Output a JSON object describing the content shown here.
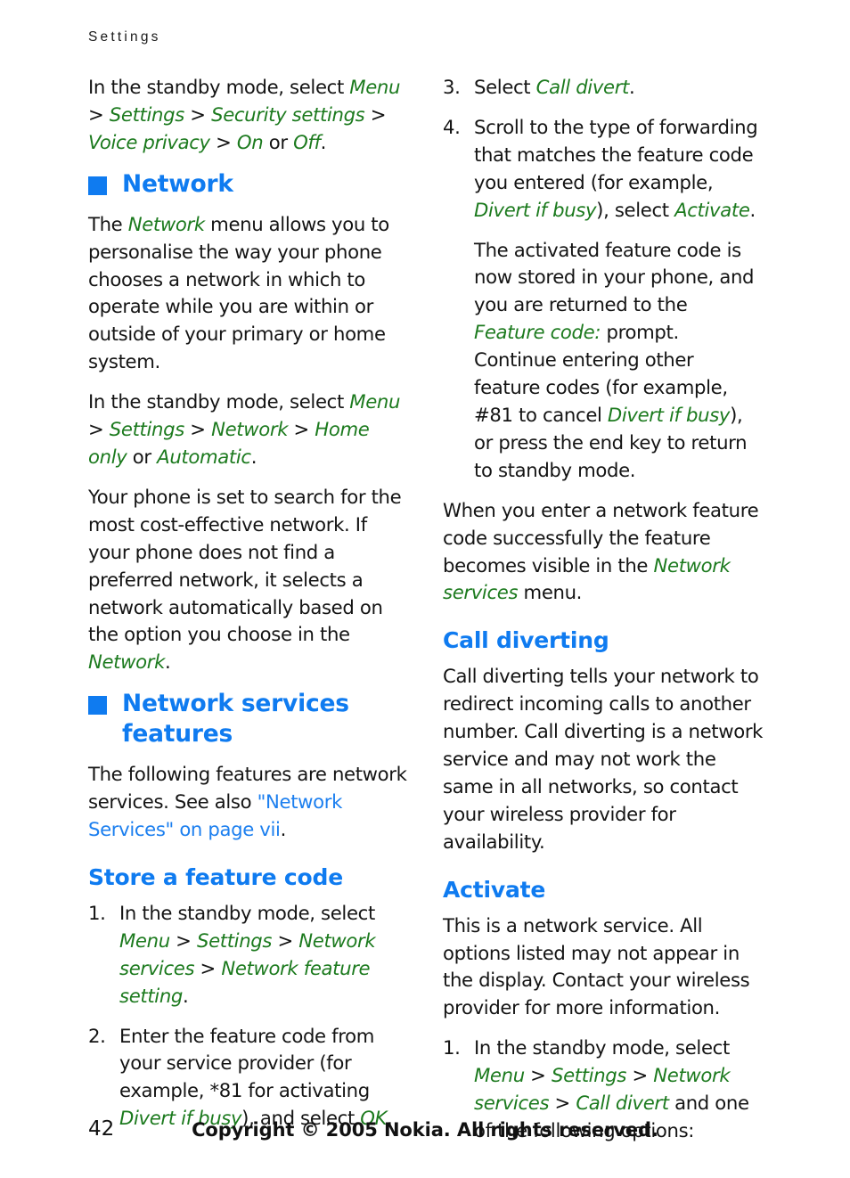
{
  "document": {
    "running_header": "Settings",
    "page_number": "42",
    "copyright": "Copyright © 2005 Nokia. All rights reserved.",
    "colors": {
      "heading_blue": "#0f7bf0",
      "link_blue": "#1c7fef",
      "emphasis_green": "#1c7a1e",
      "body_text": "#141414",
      "page_background": "#ffffff"
    }
  },
  "left_column": {
    "intro_paragraph": {
      "lead": "In the standby mode, select ",
      "menu": "Menu",
      "sep1": " > ",
      "settings": "Settings",
      "sep2": " > ",
      "security_settings": "Security settings",
      "sep3": " > ",
      "voice_privacy": "Voice privacy",
      "sep4": " > ",
      "on": "On",
      "or": " or ",
      "off": "Off",
      "period": "."
    },
    "network_heading": "Network",
    "network_paragraph": {
      "part1": "The ",
      "network": "Network",
      "part2": " menu allows you to personalise the way your phone chooses a network in which to operate while you are within or outside of your primary or home system."
    },
    "network_path_paragraph": {
      "lead": "In the standby mode, select ",
      "menu": "Menu",
      "sep1": " > ",
      "settings": "Settings",
      "sep2": " > ",
      "network": "Network",
      "sep3": " > ",
      "home_only": "Home only",
      "or": " or ",
      "automatic": "Automatic",
      "period": "."
    },
    "search_paragraph": {
      "part1": "Your phone is set to search for the most cost-effective network. If your phone does not find a preferred network, it selects a network automatically based on the option you choose in the ",
      "network": "Network",
      "period": "."
    },
    "services_heading_line1": "Network services",
    "services_heading_line2": "features",
    "services_paragraph": {
      "part1": "The following features are network services. See also ",
      "link": "\"Network Services\" on page vii",
      "period": "."
    },
    "store_heading": "Store a feature code",
    "store_steps": [
      {
        "num": "1.",
        "lead": "In the standby mode, select ",
        "menu": "Menu",
        "sep1": " > ",
        "settings": "Settings",
        "sep2": " > ",
        "network_services": "Network services",
        "sep3": " > ",
        "network_feature_setting": "Network feature setting",
        "period": "."
      },
      {
        "num": "2.",
        "part1": "Enter the feature code from your service provider (for example, *81 for activating ",
        "divert_if_busy": "Divert if busy",
        "part2": "), and select ",
        "ok": "OK",
        "period": "."
      }
    ]
  },
  "right_column": {
    "steps": [
      {
        "num": "3.",
        "lead": "Select ",
        "call_divert": "Call divert",
        "period": "."
      },
      {
        "num": "4.",
        "part1": "Scroll to the type of forwarding that matches the feature code you entered (for example, ",
        "divert_if_busy": "Divert if busy",
        "part2": "), select ",
        "activate": "Activate",
        "period": ".",
        "sub_paragraph": {
          "part1": "The activated feature code is now stored in your phone, and you are returned to the ",
          "feature_code": "Feature code:",
          "part2": " prompt. Continue entering other feature codes (for example, #81 to cancel ",
          "divert_if_busy": "Divert if busy",
          "part3": "), or press the end key to return to standby mode."
        }
      }
    ],
    "visible_paragraph": {
      "part1": "When you enter a network feature code successfully the feature becomes visible in the ",
      "network_services": "Network services",
      "part2": " menu."
    },
    "call_diverting_heading": "Call diverting",
    "call_diverting_paragraph": "Call diverting tells your network to redirect incoming calls to another number. Call diverting is a network service and may not work the same in all networks, so contact your wireless provider for availability.",
    "activate_heading": "Activate",
    "activate_paragraph": "This is a network service. All options listed may not appear in the display. Contact your wireless provider for more information.",
    "activate_steps": [
      {
        "num": "1.",
        "lead": "In the standby mode, select ",
        "menu": "Menu",
        "sep1": " > ",
        "settings": "Settings",
        "sep2": " > ",
        "network_services": "Network services",
        "sep3": " > ",
        "call_divert": "Call divert",
        "part2": " and one of the following options:"
      }
    ]
  }
}
